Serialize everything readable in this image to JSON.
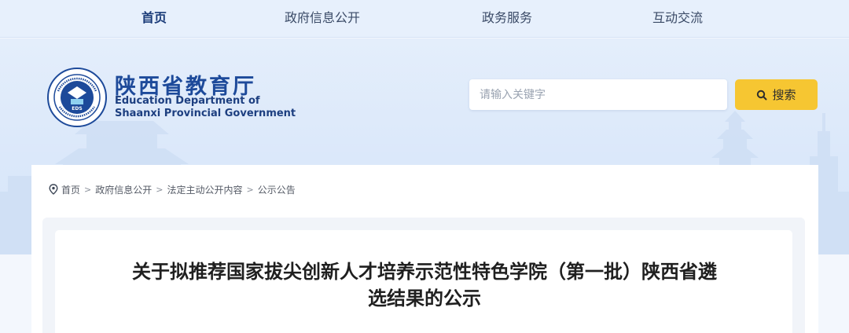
{
  "nav": {
    "items": [
      {
        "label": "首页",
        "active": true
      },
      {
        "label": "政府信息公开",
        "active": false
      },
      {
        "label": "政务服务",
        "active": false
      },
      {
        "label": "互动交流",
        "active": false
      }
    ]
  },
  "header": {
    "logo_seal_text": "EDUCATION DEPARTMENT OF SHAANXI",
    "logo_seal_inner": "EDS",
    "logo_seal_bottom": "陕西省教育厅",
    "name_cn": "陕西省教育厅",
    "name_en_line1": "Education Department of",
    "name_en_line2": "Shaanxi Provincial Government"
  },
  "search": {
    "placeholder": "请输入关键字",
    "value": "",
    "button_label": "搜索"
  },
  "breadcrumb": [
    "首页",
    "政府信息公开",
    "法定主动公开内容",
    "公示公告"
  ],
  "article": {
    "title_line1": "关于拟推荐国家拔尖创新人才培养示范性特色学院（第一批）陕西省遴",
    "title_line2": "选结果的公示"
  },
  "colors": {
    "brand_blue": "#1d4a9a",
    "nav_bg": "#e7f0fc",
    "search_button": "#f6c632",
    "banner_bg": "#dbe8fa"
  }
}
